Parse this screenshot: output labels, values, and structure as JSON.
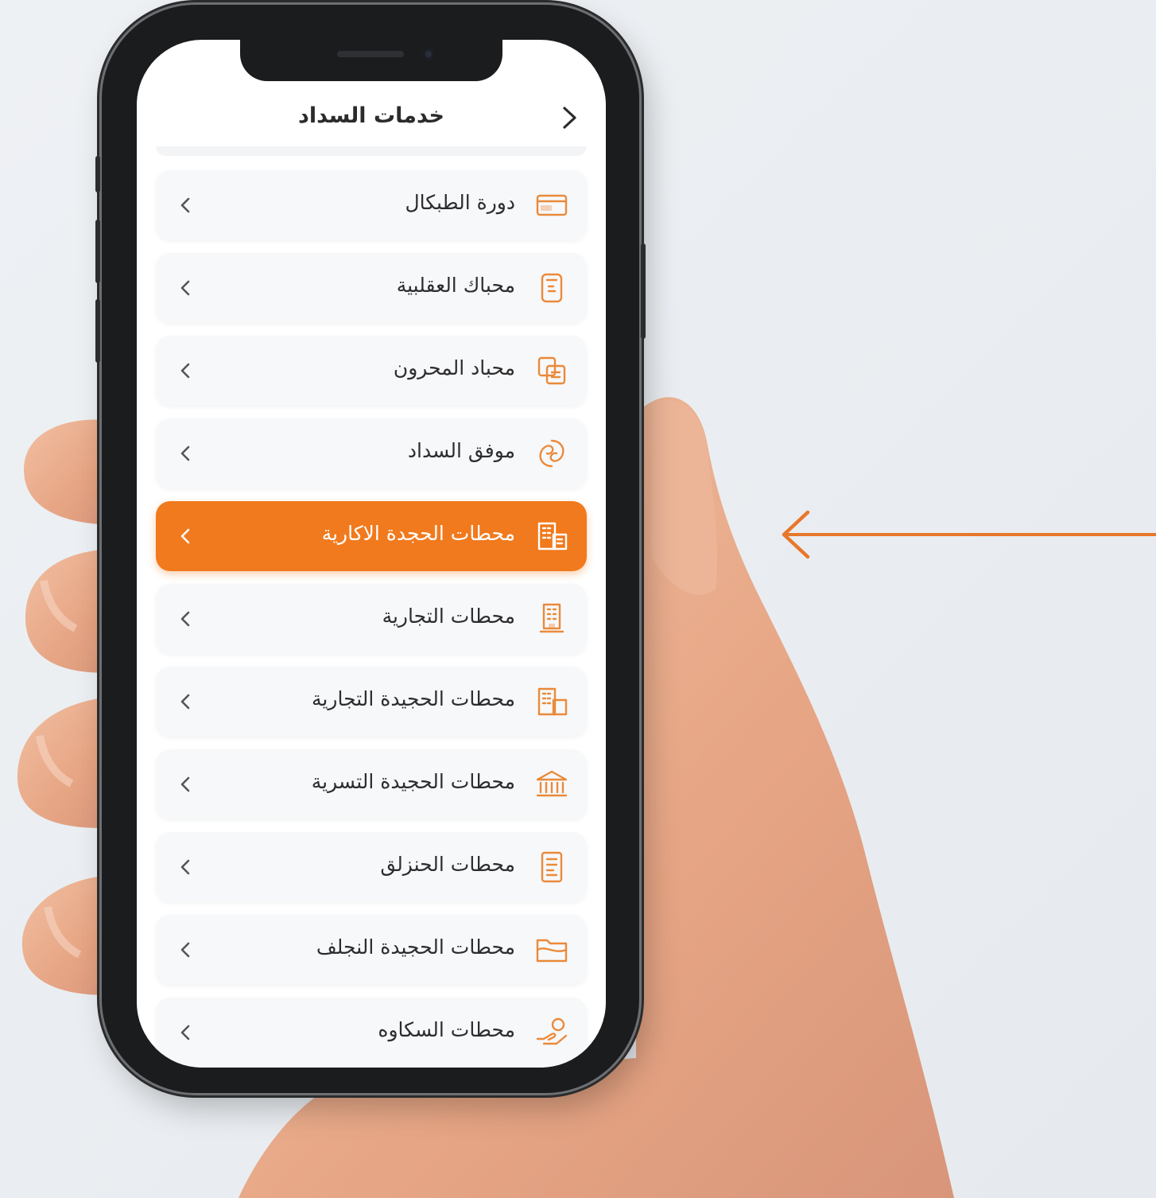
{
  "colors": {
    "accent": "#f07a1d",
    "text": "#2d2d2d",
    "card": "#f7f8fa"
  },
  "header": {
    "title": "خدمات السداد",
    "back_icon": "chevron-right-icon"
  },
  "items": [
    {
      "label": "دورة الطبكال",
      "icon": "card-icon",
      "active": false
    },
    {
      "label": "محباك العقلبية",
      "icon": "document-icon",
      "active": false
    },
    {
      "label": "محباد المحرون",
      "icon": "copy-icon",
      "active": false
    },
    {
      "label": "موفق السداد",
      "icon": "pay-icon",
      "active": false
    },
    {
      "label": "محطات الحجدة الاكارية",
      "icon": "building-icon",
      "active": true
    },
    {
      "label": "محطات التجارية",
      "icon": "tower-icon",
      "active": false
    },
    {
      "label": "محطات الحجيدة التجارية",
      "icon": "buildings-icon",
      "active": false
    },
    {
      "label": "محطات الحجيدة التسرية",
      "icon": "bank-icon",
      "active": false
    },
    {
      "label": "محطات الحنزلق",
      "icon": "receipt-icon",
      "active": false
    },
    {
      "label": "محطات الحجيدة النجلف",
      "icon": "folder-icon",
      "active": false
    },
    {
      "label": "محطات السكاوه",
      "icon": "hand-coin-icon",
      "active": false
    }
  ]
}
